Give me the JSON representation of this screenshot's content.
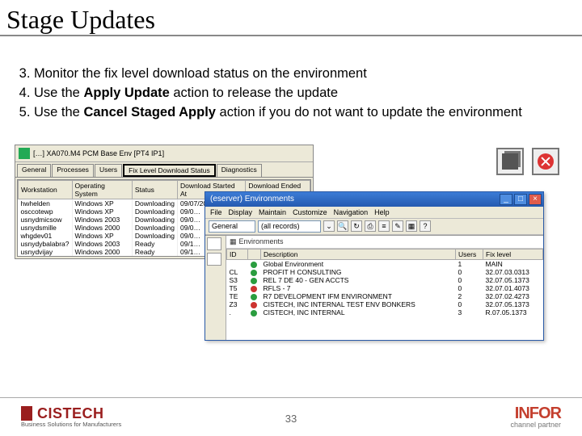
{
  "title": "Stage Updates",
  "bullets": [
    {
      "n": "3.",
      "pre": "Monitor the fix level download status on the environment",
      "bold": "",
      "post": ""
    },
    {
      "n": "4.",
      "pre": "Use the ",
      "bold": "Apply Update",
      "post": " action to release the update"
    },
    {
      "n": "5.",
      "pre": "Use the ",
      "bold": "Cancel Staged Apply",
      "post": " action if you do not want to update the environment"
    }
  ],
  "win1": {
    "title": "[…] XA070.M4  PCM Base Env  [PT4 IP1]",
    "tabs": [
      "General",
      "Processes",
      "Users",
      "Fix Level Download Status",
      "Diagnostics"
    ],
    "active_tab": "Fix Level Download Status",
    "columns": [
      "Workstation",
      "Operating System",
      "Status",
      "Download Started At",
      "Download Ended At"
    ],
    "rows": [
      [
        "hwhelden",
        "Windows XP",
        "Downloading",
        "09/07/2007 3:19 PM",
        ""
      ],
      [
        "osccotewp",
        "Windows XP",
        "Downloading",
        "09/0…",
        ""
      ],
      [
        "usnydmicsow",
        "Windows 2003",
        "Downloading",
        "09/0…",
        ""
      ],
      [
        "usnydsmille",
        "Windows 2000",
        "Downloading",
        "09/0…",
        ""
      ],
      [
        "whgdev01",
        "Windows XP",
        "Downloading",
        "09/0…",
        ""
      ],
      [
        "usnydybalabra?",
        "Windows 2003",
        "Ready",
        "09/1…",
        ""
      ],
      [
        "usnydvijay",
        "Windows 2000",
        "Ready",
        "09/1…",
        ""
      ]
    ]
  },
  "win2": {
    "title": "(eserver) Environments",
    "menu": [
      "File",
      "Display",
      "Maintain",
      "Customize",
      "Navigation",
      "Help"
    ],
    "toolbar": {
      "field1": "General",
      "field2": "(all records)"
    },
    "panel_label": "Environments",
    "columns": [
      "ID",
      "",
      "Description",
      "Users",
      "Fix level"
    ],
    "rows": [
      {
        "c": "green",
        "id": "",
        "desc": "Global Environment",
        "users": "1",
        "fix": "MAIN"
      },
      {
        "c": "green",
        "id": "CL",
        "desc": "PROFIT H CONSULTING",
        "users": "0",
        "fix": "32.07.03.0313"
      },
      {
        "c": "green",
        "id": "S3",
        "desc": "REL 7 DE 40 - GEN ACCTS",
        "users": "0",
        "fix": "32.07.05.1373"
      },
      {
        "c": "red",
        "id": "T5",
        "desc": "RFLS - 7",
        "users": "0",
        "fix": "32.07.01.4073"
      },
      {
        "c": "green",
        "id": "TE",
        "desc": "R7 DEVELOPMENT IFM ENVIRONMENT",
        "users": "2",
        "fix": "32.07.02.4273"
      },
      {
        "c": "red",
        "id": "Z3",
        "desc": "CISTECH, INC INTERNAL TEST ENV BONKERS",
        "users": "0",
        "fix": "32.07.05.1373"
      },
      {
        "c": "green",
        "id": ".",
        "desc": "CISTECH, INC INTERNAL",
        "users": "3",
        "fix": "R.07.05.1373"
      }
    ]
  },
  "footer": {
    "page": "33",
    "left_brand": "CISTECH",
    "left_tag": "Business Solutions for Manufacturers",
    "right_brand": "INFOR",
    "right_tag": "channel partner"
  }
}
